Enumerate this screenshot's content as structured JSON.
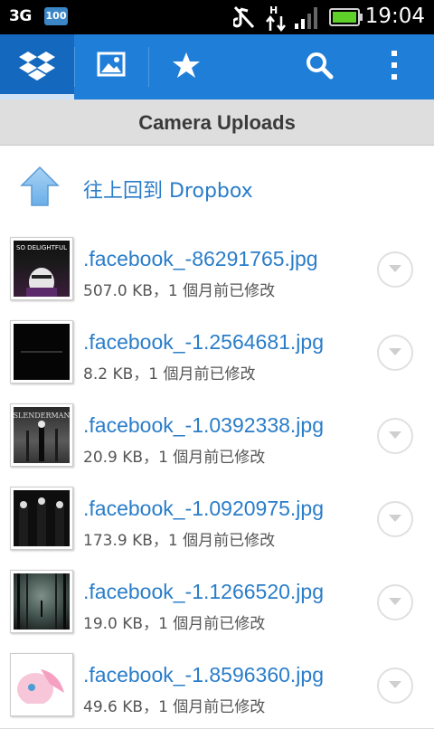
{
  "status_bar": {
    "network": "3G",
    "battery_badge": "100",
    "time": "19:04"
  },
  "action_bar": {
    "tabs": [
      {
        "icon": "dropbox-icon",
        "selected": true
      },
      {
        "icon": "photos-icon",
        "selected": false
      },
      {
        "icon": "favorites-star-icon",
        "selected": false
      }
    ],
    "actions": [
      {
        "icon": "search-icon"
      },
      {
        "icon": "overflow-menu-icon"
      }
    ]
  },
  "folder": {
    "title": "Camera Uploads",
    "up_label": "往上回到 Dropbox"
  },
  "files": [
    {
      "name": ".facebook_-86291765.jpg",
      "meta": "507.0 KB，1 個月前已修改",
      "thumb_text": "SO DELIGHTFUL"
    },
    {
      "name": ".facebook_-1.2564681.jpg",
      "meta": "8.2 KB，1 個月前已修改",
      "thumb_text": ""
    },
    {
      "name": ".facebook_-1.0392338.jpg",
      "meta": "20.9 KB，1 個月前已修改",
      "thumb_text": "SLENDERMAN"
    },
    {
      "name": ".facebook_-1.0920975.jpg",
      "meta": "173.9 KB，1 個月前已修改",
      "thumb_text": ""
    },
    {
      "name": ".facebook_-1.1266520.jpg",
      "meta": "19.0 KB，1 個月前已修改",
      "thumb_text": ""
    },
    {
      "name": ".facebook_-1.8596360.jpg",
      "meta": "49.6 KB，1 個月前已修改",
      "thumb_text": ""
    }
  ],
  "colors": {
    "action_bar": "#1f7fd8",
    "link_blue": "#2a7dc9",
    "battery_green": "#5fcf2a"
  }
}
